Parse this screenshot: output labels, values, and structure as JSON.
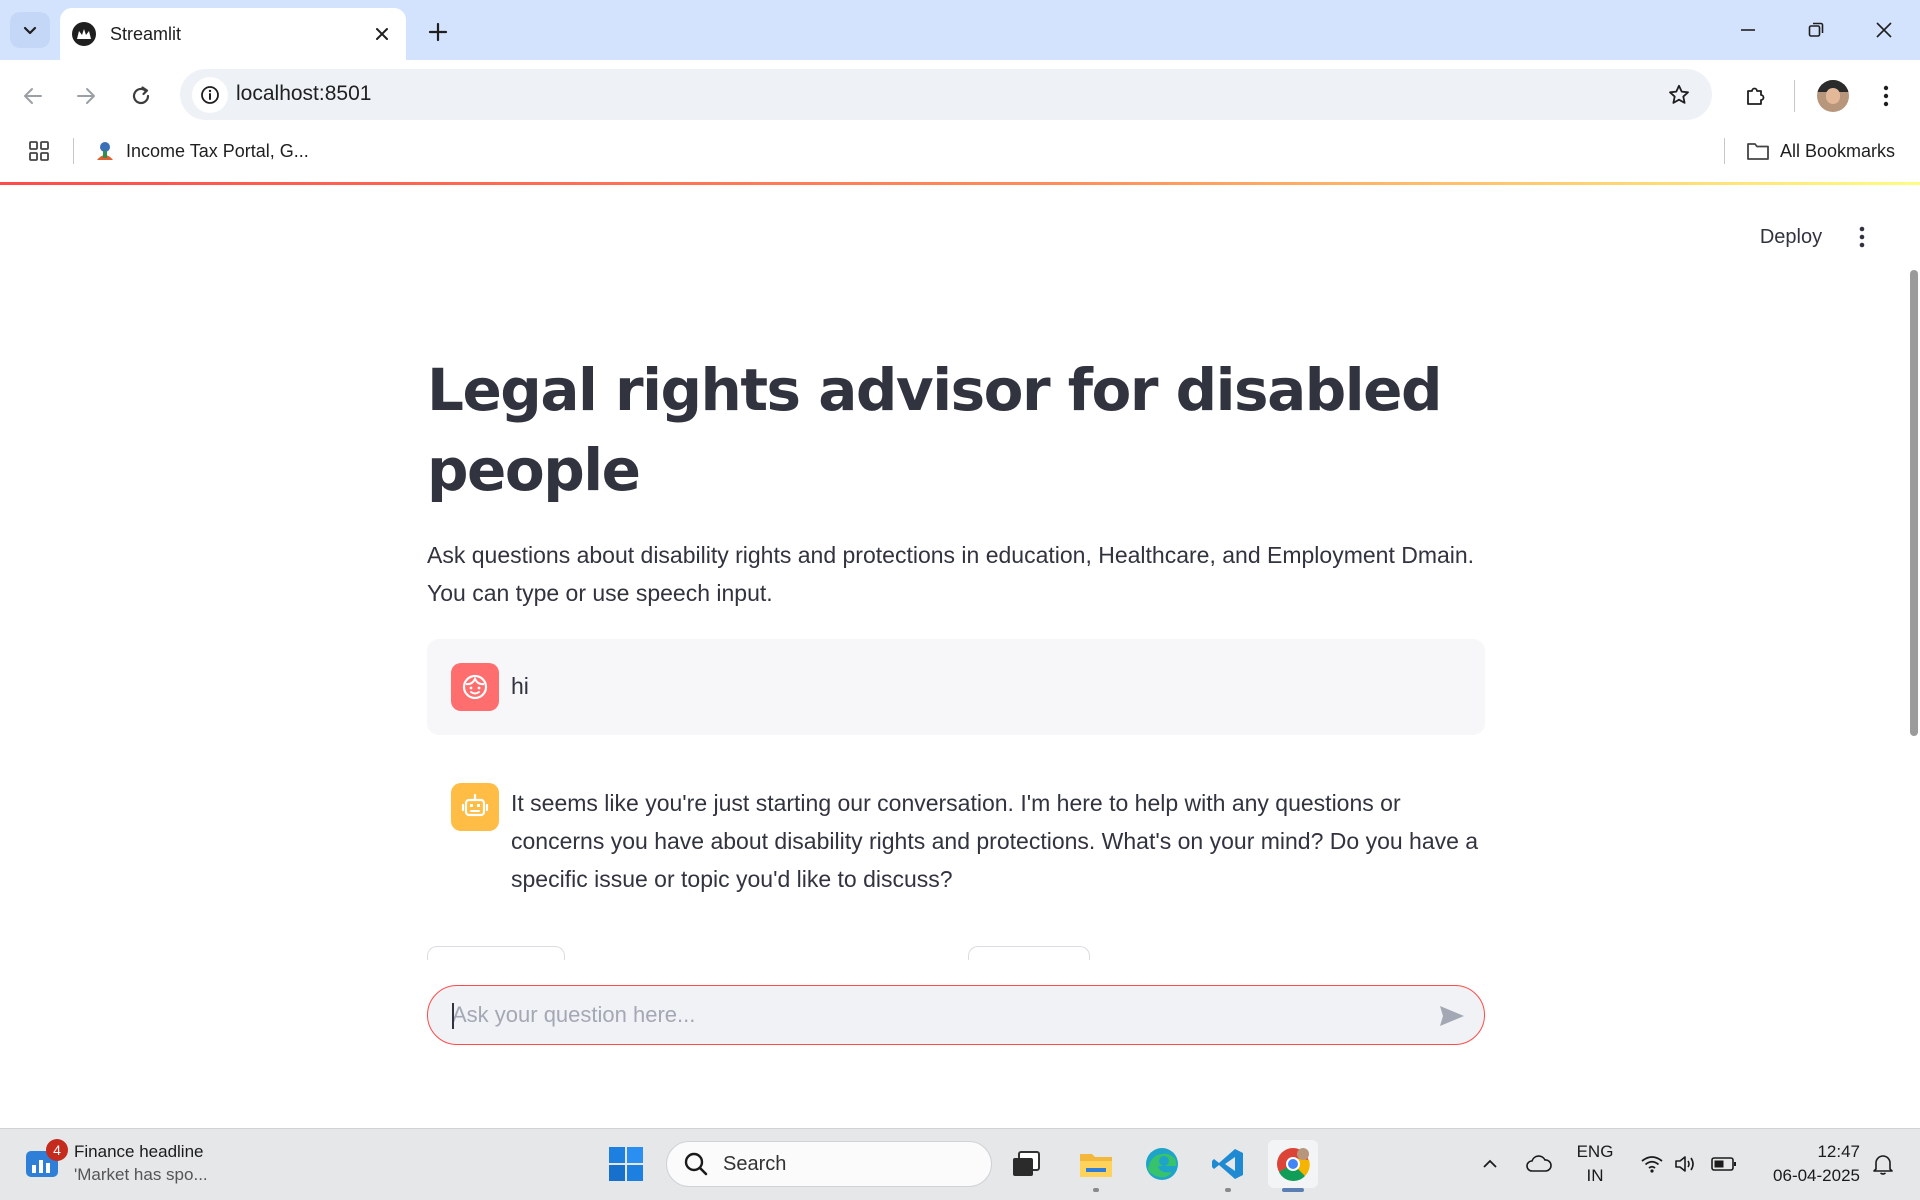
{
  "browser": {
    "tab_title": "Streamlit",
    "url": "localhost:8501",
    "bookmarks": [
      {
        "label": "Income Tax Portal, G...",
        "icon": "income-tax-favicon"
      }
    ],
    "all_bookmarks_label": "All Bookmarks"
  },
  "app": {
    "deploy_label": "Deploy",
    "title": "Legal rights advisor for disabled people",
    "description": "Ask questions about disability rights and protections in education, Healthcare, and Employment Dmain. You can type or use speech input.",
    "messages": [
      {
        "role": "user",
        "text": "hi",
        "icon": "user-face-icon",
        "color": "#ff6e6e"
      },
      {
        "role": "assistant",
        "text": "It seems like you're just starting our conversation. I'm here to help with any questions or concerns you have about disability rights and protections. What's on your mind? Do you have a specific issue or topic you'd like to discuss?",
        "icon": "bot-icon",
        "color": "#ffbd45"
      }
    ],
    "chat_input": {
      "placeholder": "Ask your question here...",
      "value": ""
    },
    "accent_color": "#ff4b4b"
  },
  "taskbar": {
    "widget": {
      "badge": "4",
      "title": "Finance headline",
      "subtitle": "'Market has spo..."
    },
    "search_label": "Search",
    "language_line1": "ENG",
    "language_line2": "IN",
    "time": "12:47",
    "date": "06-04-2025"
  }
}
